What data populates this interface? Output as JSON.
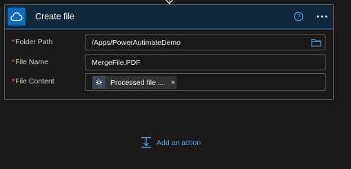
{
  "card": {
    "title": "Create file",
    "icon": "onedrive-cloud-icon",
    "header_color": "#10273c",
    "icon_bg": "#0f6cbd"
  },
  "fields": {
    "folder_path": {
      "required_mark": "*",
      "label": "Folder Path",
      "value": "/Apps/PowerAutimateDemo"
    },
    "file_name": {
      "required_mark": "*",
      "label": "File Name",
      "value": "MergeFile.PDF"
    },
    "file_content": {
      "required_mark": "*",
      "label": "File Content",
      "token_label": "Processed file ...",
      "token_remove": "×"
    }
  },
  "footer": {
    "add_action_label": "Add an action"
  },
  "colors": {
    "accent": "#4aa3f0",
    "required": "#e85a5a"
  }
}
